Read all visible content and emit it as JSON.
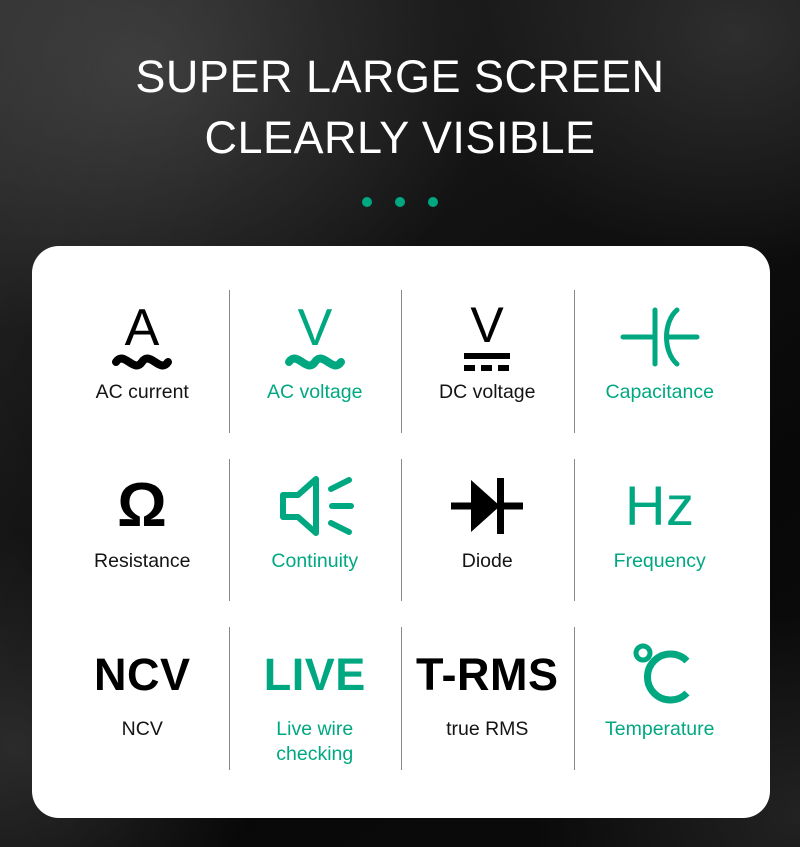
{
  "theme": {
    "accent_color": "#00a881",
    "text_color": "#141414",
    "card_background": "#ffffff",
    "page_background": "#0a0a0a"
  },
  "header": {
    "headline": "SUPER LARGE SCREEN\nCLEARLY VISIBLE",
    "headline_line1": "SUPER LARGE SCREEN",
    "headline_line2": "CLEARLY VISIBLE",
    "dots_count": 3
  },
  "features": {
    "rows": [
      [
        {
          "label": "AC current",
          "glyph_text": "A",
          "icon": "ac-current-icon",
          "accent": false
        },
        {
          "label": "AC voltage",
          "glyph_text": "V",
          "icon": "ac-voltage-icon",
          "accent": true
        },
        {
          "label": "DC voltage",
          "glyph_text": "V",
          "icon": "dc-voltage-icon",
          "accent": false
        },
        {
          "label": "Capacitance",
          "glyph_text": "",
          "icon": "capacitor-icon",
          "accent": true
        }
      ],
      [
        {
          "label": "Resistance",
          "glyph_text": "Ω",
          "icon": "ohm-icon",
          "accent": false
        },
        {
          "label": "Continuity",
          "glyph_text": "",
          "icon": "speaker-icon",
          "accent": true
        },
        {
          "label": "Diode",
          "glyph_text": "",
          "icon": "diode-icon",
          "accent": false
        },
        {
          "label": "Frequency",
          "glyph_text": "Hz",
          "icon": "hertz-icon",
          "accent": true
        }
      ],
      [
        {
          "label": "NCV",
          "glyph_text": "NCV",
          "icon": "ncv-icon",
          "accent": false
        },
        {
          "label": "Live wire checking",
          "glyph_text": "LIVE",
          "icon": "live-icon",
          "accent": true
        },
        {
          "label": "true RMS",
          "glyph_text": "T-RMS",
          "icon": "trms-icon",
          "accent": false
        },
        {
          "label": "Temperature",
          "glyph_text": "℃",
          "icon": "temperature-icon",
          "accent": true
        }
      ]
    ]
  }
}
